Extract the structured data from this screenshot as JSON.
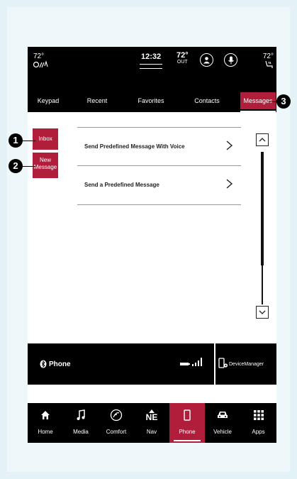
{
  "status": {
    "temp_left": "72°",
    "clock": "12:32",
    "temp_out": "72°",
    "out_label": "OUT",
    "temp_right": "72°"
  },
  "tabs": [
    {
      "label": "Keypad"
    },
    {
      "label": "Recent"
    },
    {
      "label": "Favorites"
    },
    {
      "label": "Contacts"
    },
    {
      "label": "Messages"
    }
  ],
  "side_buttons": {
    "inbox": "Inbox",
    "new_message_line1": "New",
    "new_message_line2": "Message"
  },
  "list": [
    {
      "label": "Send Predefined Message With Voice"
    },
    {
      "label": "Send a Predefined Message"
    }
  ],
  "phone_bar": {
    "label": "Phone",
    "device_manager": "DeviceManager"
  },
  "nav": [
    {
      "label": "Home",
      "icon": "home-icon"
    },
    {
      "label": "Media",
      "icon": "music-note-icon"
    },
    {
      "label": "Comfort",
      "icon": "comfort-icon"
    },
    {
      "label": "Nav",
      "icon": "compass-icon",
      "heading": "NE"
    },
    {
      "label": "Phone",
      "icon": "phone-icon"
    },
    {
      "label": "Vehicle",
      "icon": "car-icon"
    },
    {
      "label": "Apps",
      "icon": "apps-grid-icon"
    }
  ],
  "callouts": [
    "1",
    "2",
    "3"
  ],
  "colors": {
    "accent": "#b01e3c",
    "bar": "#000000"
  }
}
